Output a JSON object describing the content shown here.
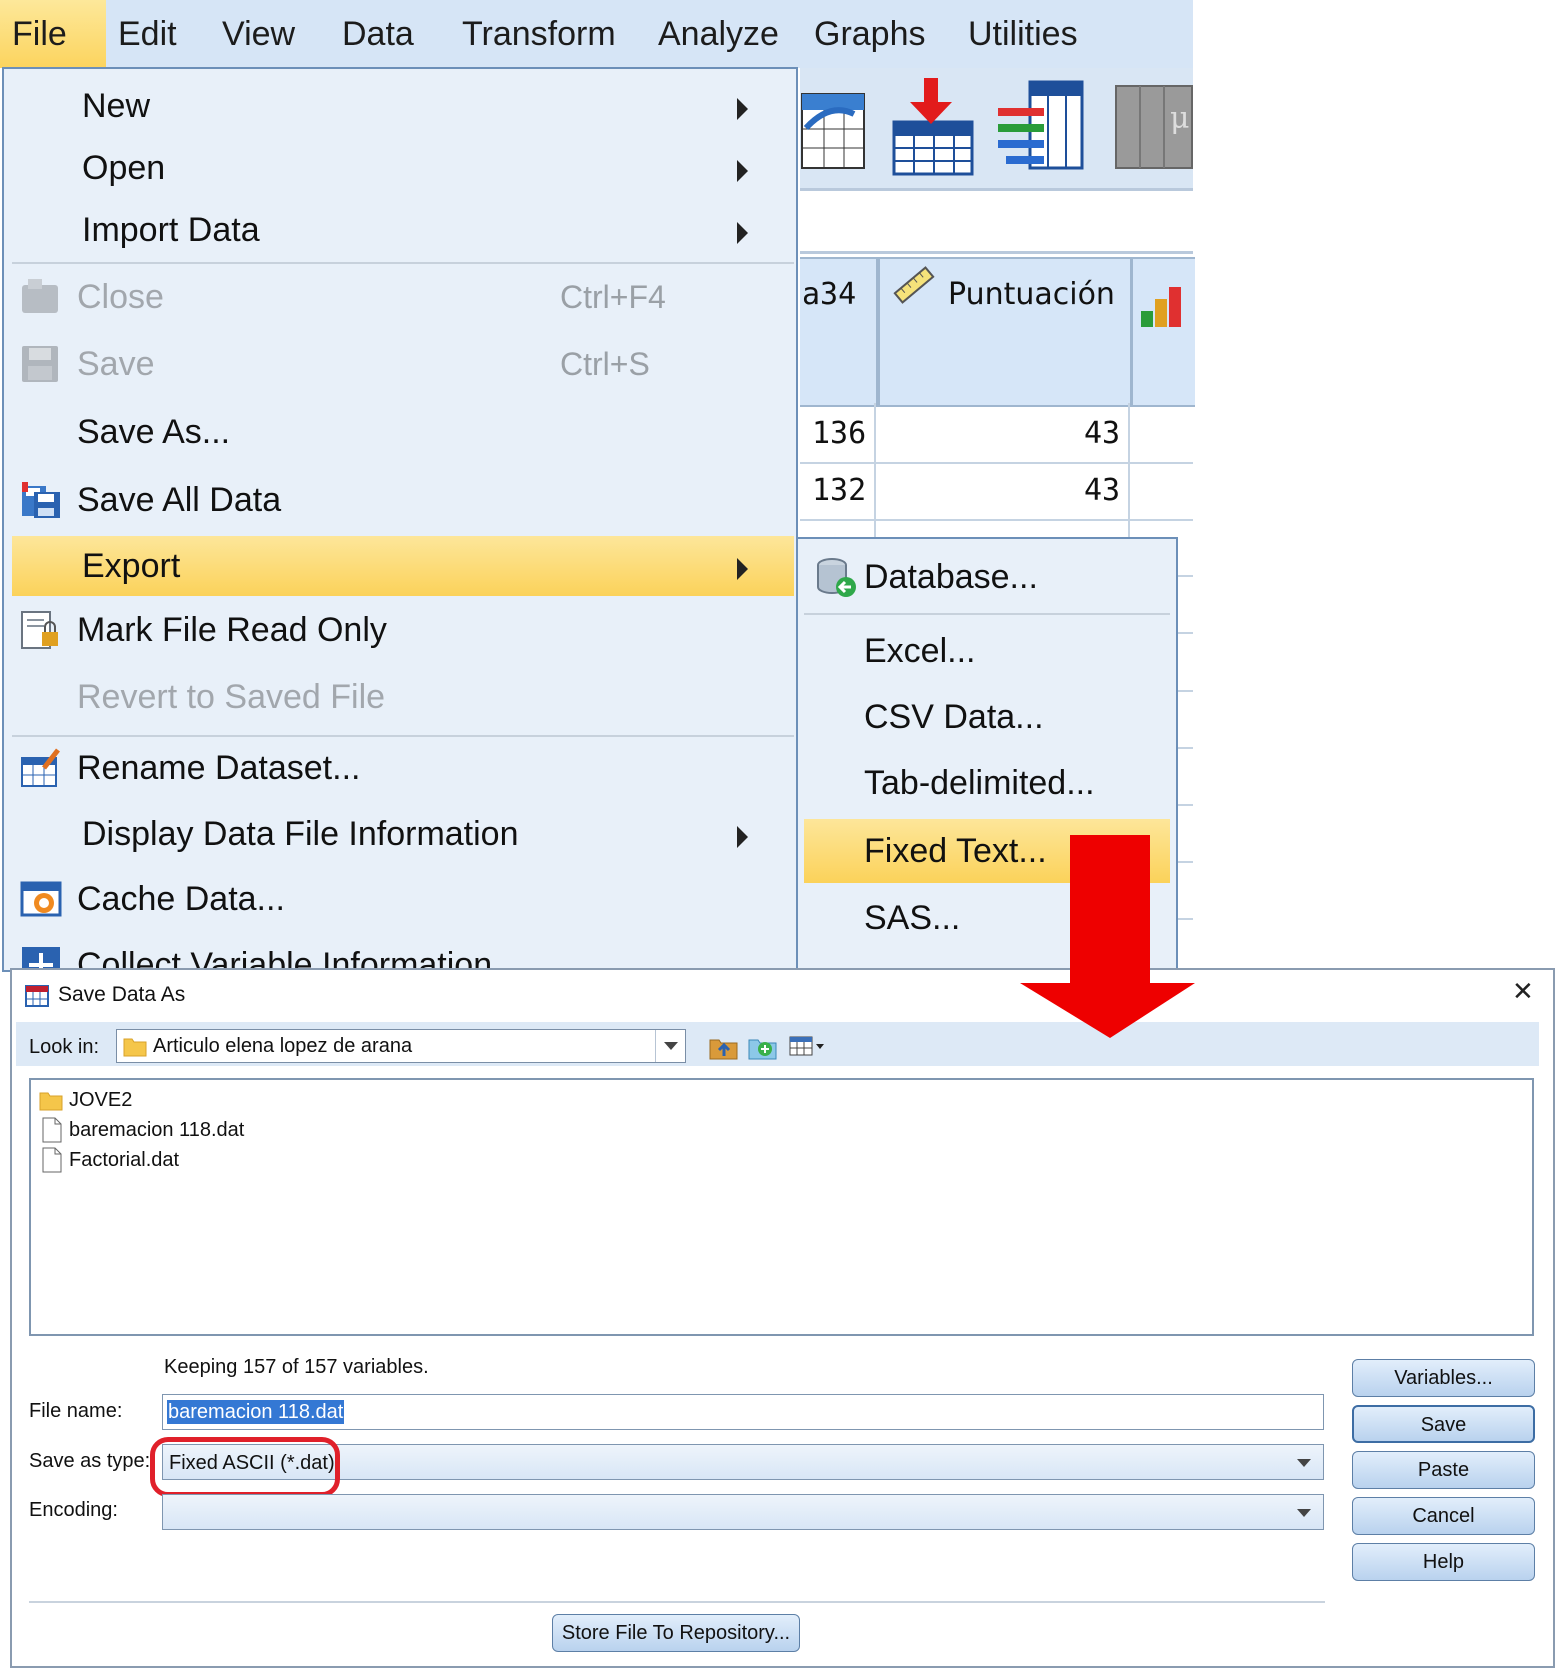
{
  "menubar": {
    "items": [
      "File",
      "Edit",
      "View",
      "Data",
      "Transform",
      "Analyze",
      "Graphs",
      "Utilities"
    ],
    "active": "File"
  },
  "data_editor": {
    "partial_column": "a34",
    "column_header": "Puntuación",
    "rows": [
      {
        "left": "136",
        "right": "43"
      },
      {
        "left": "132",
        "right": "43"
      }
    ]
  },
  "file_menu": {
    "items": [
      {
        "label": "New",
        "has_submenu": true
      },
      {
        "label": "Open",
        "has_submenu": true
      },
      {
        "label": "Import Data",
        "has_submenu": true
      },
      {
        "label": "Close",
        "shortcut": "Ctrl+F4",
        "disabled": true,
        "icon": "close-dataset-icon"
      },
      {
        "label": "Save",
        "shortcut": "Ctrl+S",
        "disabled": true,
        "icon": "save-disk-icon"
      },
      {
        "label": "Save As..."
      },
      {
        "label": "Save All Data",
        "icon": "save-all-icon"
      },
      {
        "label": "Export",
        "has_submenu": true,
        "highlighted": true
      },
      {
        "label": "Mark File Read Only",
        "icon": "read-only-lock-icon"
      },
      {
        "label": "Revert to Saved File",
        "disabled": true
      },
      {
        "label": "Rename Dataset...",
        "icon": "rename-dataset-icon"
      },
      {
        "label": "Display Data File Information",
        "has_submenu": true
      },
      {
        "label": "Cache Data...",
        "icon": "cache-data-icon"
      },
      {
        "label": "Collect Variable Information",
        "icon": "collect-variable-icon"
      }
    ]
  },
  "export_submenu": {
    "items": [
      {
        "label": "Database...",
        "icon": "database-export-icon"
      },
      {
        "label": "Excel..."
      },
      {
        "label": "CSV Data..."
      },
      {
        "label": "Tab-delimited..."
      },
      {
        "label": "Fixed Text...",
        "highlighted": true
      },
      {
        "label": "SAS..."
      }
    ]
  },
  "dialog": {
    "title": "Save Data As",
    "look_in_label": "Look in:",
    "look_in_value": "Articulo elena lopez de arana",
    "files": [
      {
        "name": "JOVE2",
        "type": "folder"
      },
      {
        "name": "baremacion 118.dat",
        "type": "file"
      },
      {
        "name": "Factorial.dat",
        "type": "file"
      }
    ],
    "keeping_text": "Keeping 157 of 157 variables.",
    "file_name_label": "File name:",
    "file_name_value": "baremacion 118.dat",
    "save_type_label": "Save as type:",
    "save_type_value": "Fixed ASCII (*.dat)",
    "encoding_label": "Encoding:",
    "encoding_value": "",
    "buttons": {
      "variables": "Variables...",
      "save": "Save",
      "paste": "Paste",
      "cancel": "Cancel",
      "help": "Help"
    },
    "store_button": "Store File To Repository...",
    "close_glyph": "✕"
  },
  "colors": {
    "menu_highlight": "#fcd45e",
    "menu_background": "#e8f0f9",
    "annotation_red": "#e0202a",
    "selection_blue": "#3478d4"
  }
}
